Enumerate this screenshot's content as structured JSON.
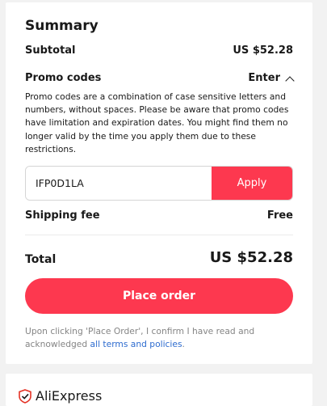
{
  "summary": {
    "title": "Summary",
    "subtotal_label": "Subtotal",
    "subtotal_value": "US $52.28",
    "promo_label": "Promo codes",
    "promo_toggle": "Enter",
    "promo_desc": "Promo codes are a combination of case sensitive letters and numbers, without spaces. Please be aware that promo codes have limitation and expiration dates. You might find them no longer valid by the time you apply them due to these restrictions.",
    "promo_input_value": "IFP0D1LA",
    "apply_label": "Apply",
    "shipping_label": "Shipping fee",
    "shipping_value": "Free",
    "total_label": "Total",
    "total_value": "US $52.28",
    "place_order_label": "Place order",
    "legal_text": "Upon clicking 'Place Order', I confirm I have read and acknowledged ",
    "legal_link": "all terms and policies",
    "legal_end": "."
  },
  "footer": {
    "brand": "AliExpress"
  },
  "colors": {
    "accent": "#fd384f",
    "link": "#2e6ccf"
  }
}
